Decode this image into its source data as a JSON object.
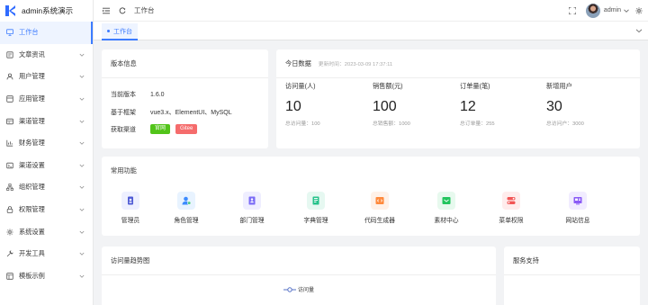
{
  "app": {
    "title": "admin系统演示"
  },
  "sidebar": {
    "items": [
      {
        "label": "工作台",
        "icon": "monitor-icon",
        "active": true,
        "has_arrow": false
      },
      {
        "label": "文章资讯",
        "icon": "article-icon",
        "active": false,
        "has_arrow": true
      },
      {
        "label": "用户管理",
        "icon": "user-icon",
        "active": false,
        "has_arrow": true
      },
      {
        "label": "应用管理",
        "icon": "app-icon",
        "active": false,
        "has_arrow": true
      },
      {
        "label": "渠道管理",
        "icon": "channel-icon",
        "active": false,
        "has_arrow": true
      },
      {
        "label": "财务管理",
        "icon": "finance-icon",
        "active": false,
        "has_arrow": true
      },
      {
        "label": "渠道设置",
        "icon": "channel-settings-icon",
        "active": false,
        "has_arrow": true
      },
      {
        "label": "组织管理",
        "icon": "organization-icon",
        "active": false,
        "has_arrow": true
      },
      {
        "label": "权限管理",
        "icon": "lock-icon",
        "active": false,
        "has_arrow": true
      },
      {
        "label": "系统设置",
        "icon": "gear-icon",
        "active": false,
        "has_arrow": true
      },
      {
        "label": "开发工具",
        "icon": "tool-icon",
        "active": false,
        "has_arrow": true
      },
      {
        "label": "模板示例",
        "icon": "template-icon",
        "active": false,
        "has_arrow": true
      }
    ]
  },
  "header": {
    "breadcrumb": "工作台",
    "username": "admin"
  },
  "tabs": [
    {
      "label": "工作台"
    }
  ],
  "version_card": {
    "title": "版本信息",
    "rows": [
      {
        "key": "当前版本",
        "value": "1.6.0"
      },
      {
        "key": "基于框架",
        "value": "vue3.x、ElementUI、MySQL"
      },
      {
        "key": "获取渠道",
        "value": ""
      }
    ],
    "channel_tags": [
      {
        "label": "官网",
        "color": "#52c41a"
      },
      {
        "label": "Gitee",
        "color": "#f56c6c"
      }
    ]
  },
  "today_card": {
    "title": "今日数据",
    "update_time": "更新时间：2023-03-09 17:37:11",
    "stats": [
      {
        "label": "访问量(人)",
        "value": "10",
        "total": "总访问量：100"
      },
      {
        "label": "销售额(元)",
        "value": "100",
        "total": "总销售额：1000"
      },
      {
        "label": "订单量(笔)",
        "value": "12",
        "total": "总订单量：255"
      },
      {
        "label": "新增用户",
        "value": "30",
        "total": "总访问户：3000"
      }
    ]
  },
  "functions_card": {
    "title": "常用功能",
    "items": [
      {
        "label": "管理员",
        "icon": "admin-icon",
        "bg": "#eef0ff",
        "fg": "#4f5bd5"
      },
      {
        "label": "角色管理",
        "icon": "role-icon",
        "bg": "#e8f3ff",
        "fg": "#3d8bff"
      },
      {
        "label": "部门管理",
        "icon": "department-icon",
        "bg": "#efeeff",
        "fg": "#7b6cf6"
      },
      {
        "label": "字典管理",
        "icon": "dictionary-icon",
        "bg": "#e6f8f1",
        "fg": "#25c28a"
      },
      {
        "label": "代码生成器",
        "icon": "code-generator-icon",
        "bg": "#fff1e8",
        "fg": "#ff8a3d"
      },
      {
        "label": "素材中心",
        "icon": "material-icon",
        "bg": "#e7f9ee",
        "fg": "#22c55e"
      },
      {
        "label": "菜单权限",
        "icon": "menu-permission-icon",
        "bg": "#ffecec",
        "fg": "#f25555"
      },
      {
        "label": "网站信息",
        "icon": "website-icon",
        "bg": "#f1ecff",
        "fg": "#8b5cf6"
      }
    ]
  },
  "trend_card": {
    "title": "访问量趋势图",
    "legend": "访问量"
  },
  "support_card": {
    "title": "服务支持"
  }
}
